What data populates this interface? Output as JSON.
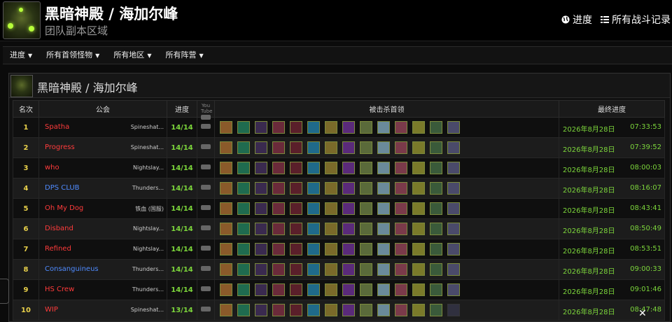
{
  "header": {
    "title": "黑暗神殿 / 海加尔峰",
    "subtitle": "团队副本区域",
    "links": [
      {
        "label": "进度",
        "icon": "globe-icon"
      },
      {
        "label": "所有战斗记录",
        "icon": "list-icon"
      }
    ]
  },
  "nav": {
    "items": [
      {
        "label": "进度"
      },
      {
        "label": "所有首领怪物"
      },
      {
        "label": "所有地区"
      },
      {
        "label": "所有阵营"
      }
    ]
  },
  "panel": {
    "title_a": "黑暗神殿",
    "title_sep": " / ",
    "title_b": "海加尔峰"
  },
  "table": {
    "columns": {
      "rank": "名次",
      "guild": "公会",
      "progress": "进度",
      "video": "You Tube",
      "bosses": "被击杀首领",
      "last": "最终进度"
    },
    "rows": [
      {
        "rank": "1",
        "guild": "Spatha",
        "realm": "Spineshat...",
        "progress": "14/14",
        "date": "2026年8月28日",
        "time": "07:33:53",
        "faction": "horde",
        "kills": 14
      },
      {
        "rank": "2",
        "guild": "Progress",
        "realm": "Spineshat...",
        "progress": "14/14",
        "date": "2026年8月28日",
        "time": "07:39:52",
        "faction": "horde",
        "kills": 14
      },
      {
        "rank": "3",
        "guild": "who",
        "realm": "Nightslay...",
        "progress": "14/14",
        "date": "2026年8月28日",
        "time": "08:00:03",
        "faction": "horde",
        "kills": 14
      },
      {
        "rank": "4",
        "guild": "DPS CLUB",
        "realm": "Thunders...",
        "progress": "14/14",
        "date": "2026年8月28日",
        "time": "08:16:07",
        "faction": "alliance",
        "kills": 14
      },
      {
        "rank": "5",
        "guild": "Oh My Dog",
        "realm": "铁血 (国服)",
        "progress": "14/14",
        "date": "2026年8月28日",
        "time": "08:43:41",
        "faction": "horde",
        "kills": 14
      },
      {
        "rank": "6",
        "guild": "Disband",
        "realm": "Nightslay...",
        "progress": "14/14",
        "date": "2026年8月28日",
        "time": "08:50:49",
        "faction": "horde",
        "kills": 14
      },
      {
        "rank": "7",
        "guild": "Refined",
        "realm": "Nightslay...",
        "progress": "14/14",
        "date": "2026年8月28日",
        "time": "08:53:51",
        "faction": "horde",
        "kills": 14
      },
      {
        "rank": "8",
        "guild": "Consanguineus",
        "realm": "Thunders...",
        "progress": "14/14",
        "date": "2026年8月28日",
        "time": "09:00:33",
        "faction": "alliance",
        "kills": 14
      },
      {
        "rank": "9",
        "guild": "HS Crew",
        "realm": "Thunders...",
        "progress": "14/14",
        "date": "2026年8月28日",
        "time": "09:01:46",
        "faction": "horde",
        "kills": 14
      },
      {
        "rank": "10",
        "guild": "WIP",
        "realm": "Spineshat...",
        "progress": "13/14",
        "date": "2026年8月28日",
        "time": "08:47:48",
        "faction": "horde",
        "kills": 13
      }
    ]
  },
  "boss_icons": [
    {
      "name": "boss-1-icon",
      "color": "#8a5a2a"
    },
    {
      "name": "boss-2-icon",
      "color": "#1f6b4f"
    },
    {
      "name": "boss-3-icon",
      "color": "#3a2a4f"
    },
    {
      "name": "boss-4-icon",
      "color": "#6a2a3a"
    },
    {
      "name": "boss-5-icon",
      "color": "#5a1f2a"
    },
    {
      "name": "boss-6-icon",
      "color": "#1f6a8a"
    },
    {
      "name": "boss-7-icon",
      "color": "#7a6a2a"
    },
    {
      "name": "boss-8-icon",
      "color": "#5a2a7a"
    },
    {
      "name": "boss-9-icon",
      "color": "#5a6a3a"
    },
    {
      "name": "boss-10-icon",
      "color": "#6a8a9a"
    },
    {
      "name": "boss-11-icon",
      "color": "#7a3a4a"
    },
    {
      "name": "boss-12-icon",
      "color": "#7a7a2a"
    },
    {
      "name": "boss-13-icon",
      "color": "#3a5a3a"
    },
    {
      "name": "boss-14-icon",
      "color": "#4a4a6a"
    }
  ],
  "colors": {
    "horde": "#ff3b3b",
    "alliance": "#4f8bff",
    "rank": "#e8d04a",
    "progress": "#7cd53b"
  }
}
